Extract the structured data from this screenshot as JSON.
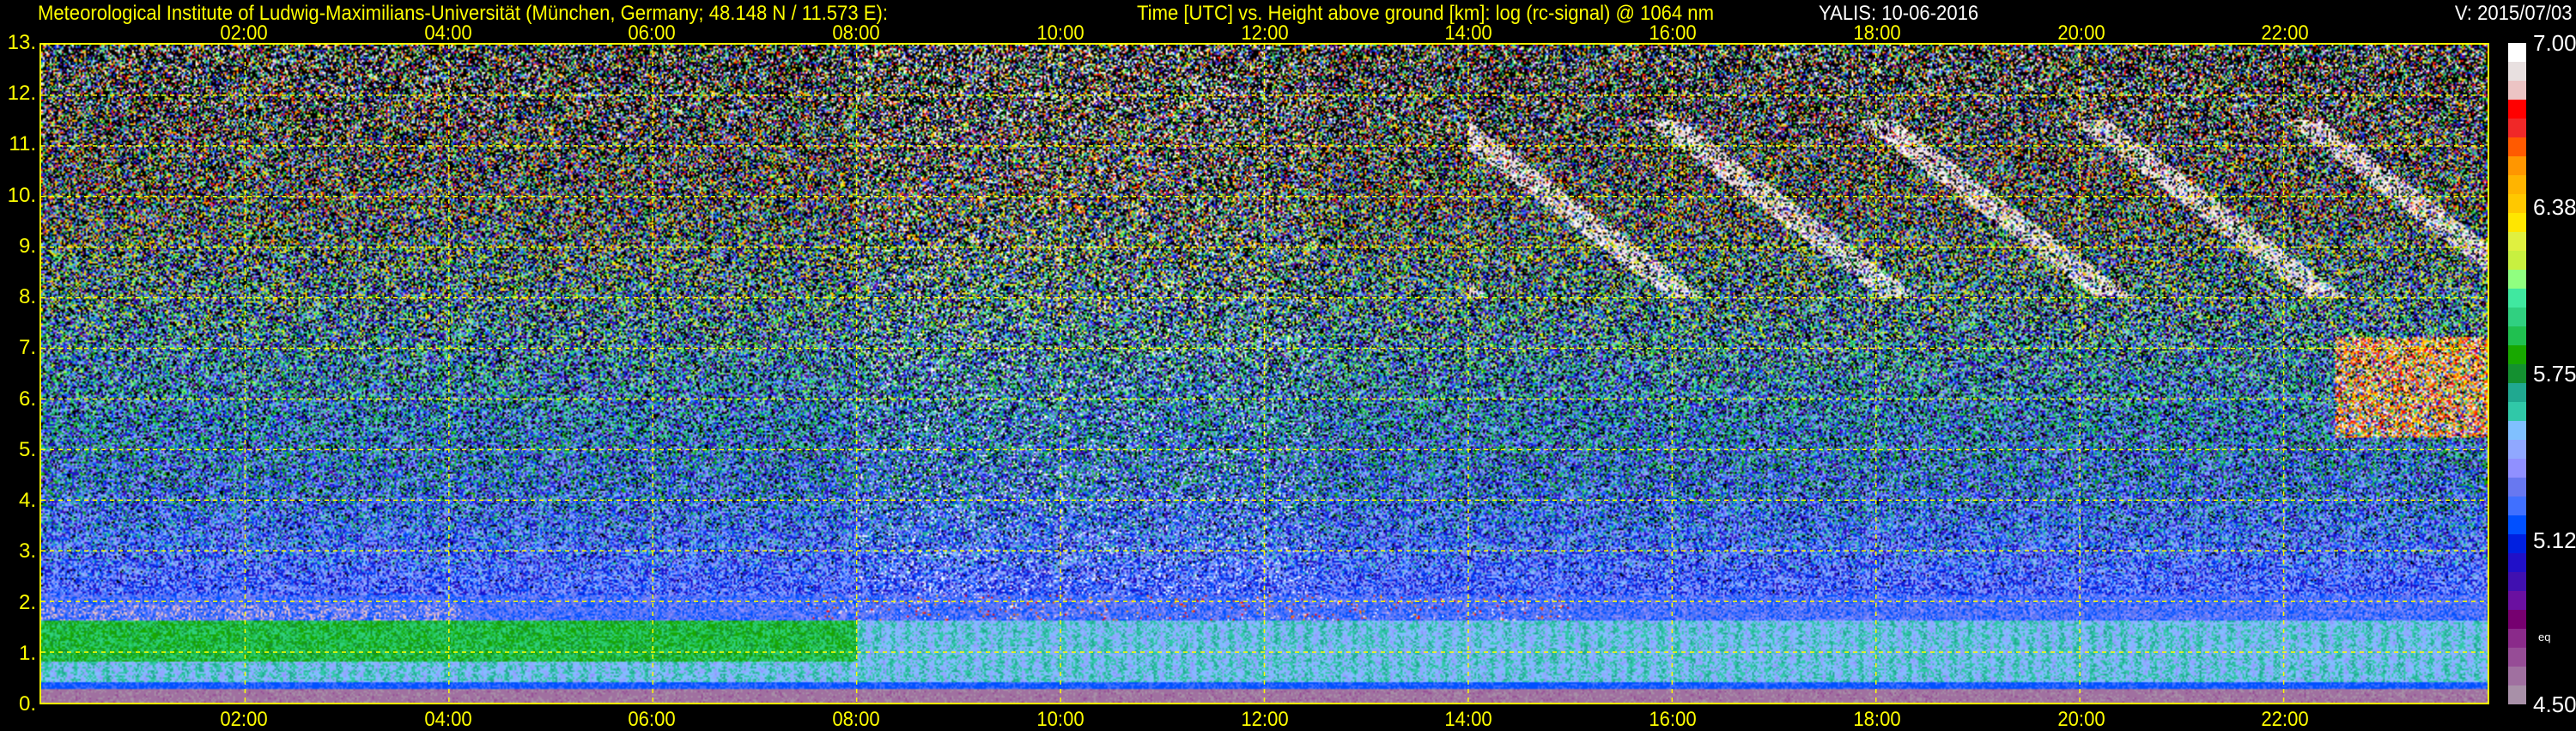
{
  "header": {
    "title": "Meteorological Institute of Ludwig-Maximilians-Universität (München, Germany; 48.148 N / 11.573 E):",
    "subtitle": "Time [UTC] vs. Height above ground [km]: log (rc-signal) @ 1064 nm",
    "station": "YALIS: 10-06-2016",
    "version": "V: 2015/07/03"
  },
  "chart_data": {
    "type": "heatmap",
    "title": "Time [UTC] vs. Height above ground [km]: log (rc-signal) @ 1064 nm",
    "xlabel": "Time [UTC]",
    "ylabel": "Height above ground [km]",
    "xlim": [
      0,
      24
    ],
    "ylim": [
      0,
      13
    ],
    "x_ticks": [
      "02:00",
      "04:00",
      "06:00",
      "08:00",
      "10:00",
      "12:00",
      "14:00",
      "16:00",
      "18:00",
      "20:00",
      "22:00"
    ],
    "x_tick_values": [
      2,
      4,
      6,
      8,
      10,
      12,
      14,
      16,
      18,
      20,
      22
    ],
    "y_ticks": [
      "0.",
      "1.",
      "2.",
      "3.",
      "4.",
      "5.",
      "6.",
      "7.",
      "8.",
      "9.",
      "10.",
      "11.",
      "12.",
      "13."
    ],
    "y_tick_values": [
      0,
      1,
      2,
      3,
      4,
      5,
      6,
      7,
      8,
      9,
      10,
      11,
      12,
      13
    ],
    "grid": true,
    "colorbar": {
      "range": [
        4.5,
        7.0
      ],
      "labels": [
        "7.00",
        "6.38",
        "5.75",
        "5.12",
        "4.50"
      ],
      "label_values": [
        7.0,
        6.38,
        5.75,
        5.12,
        4.5
      ],
      "note": "eq",
      "colors": [
        "#ffffff",
        "#e8e0e0",
        "#ecc4c4",
        "#ff0000",
        "#f02828",
        "#ff5a00",
        "#ff9600",
        "#ffb400",
        "#ffc800",
        "#ffe600",
        "#e0f040",
        "#c8f040",
        "#90ff80",
        "#40e8a0",
        "#30d080",
        "#20c050",
        "#18a800",
        "#149030",
        "#20a890",
        "#30c8a8",
        "#80c0ff",
        "#90a8ff",
        "#9090ff",
        "#6878f0",
        "#4070ff",
        "#0050ff",
        "#0020e0",
        "#2010c8",
        "#4010b0",
        "#6a10a0",
        "#760070",
        "#8a2a8a",
        "#964c96",
        "#a070a0",
        "#a890a8"
      ]
    },
    "features": {
      "boundary_layer_top_km": 1.8,
      "cloud_base_km_daytime": 1.8,
      "cirrus_km": [
        8,
        11.5
      ],
      "cirrus_hours": [
        14,
        24
      ],
      "residual_layer_night_km": [
        0.8,
        1.6
      ]
    }
  }
}
